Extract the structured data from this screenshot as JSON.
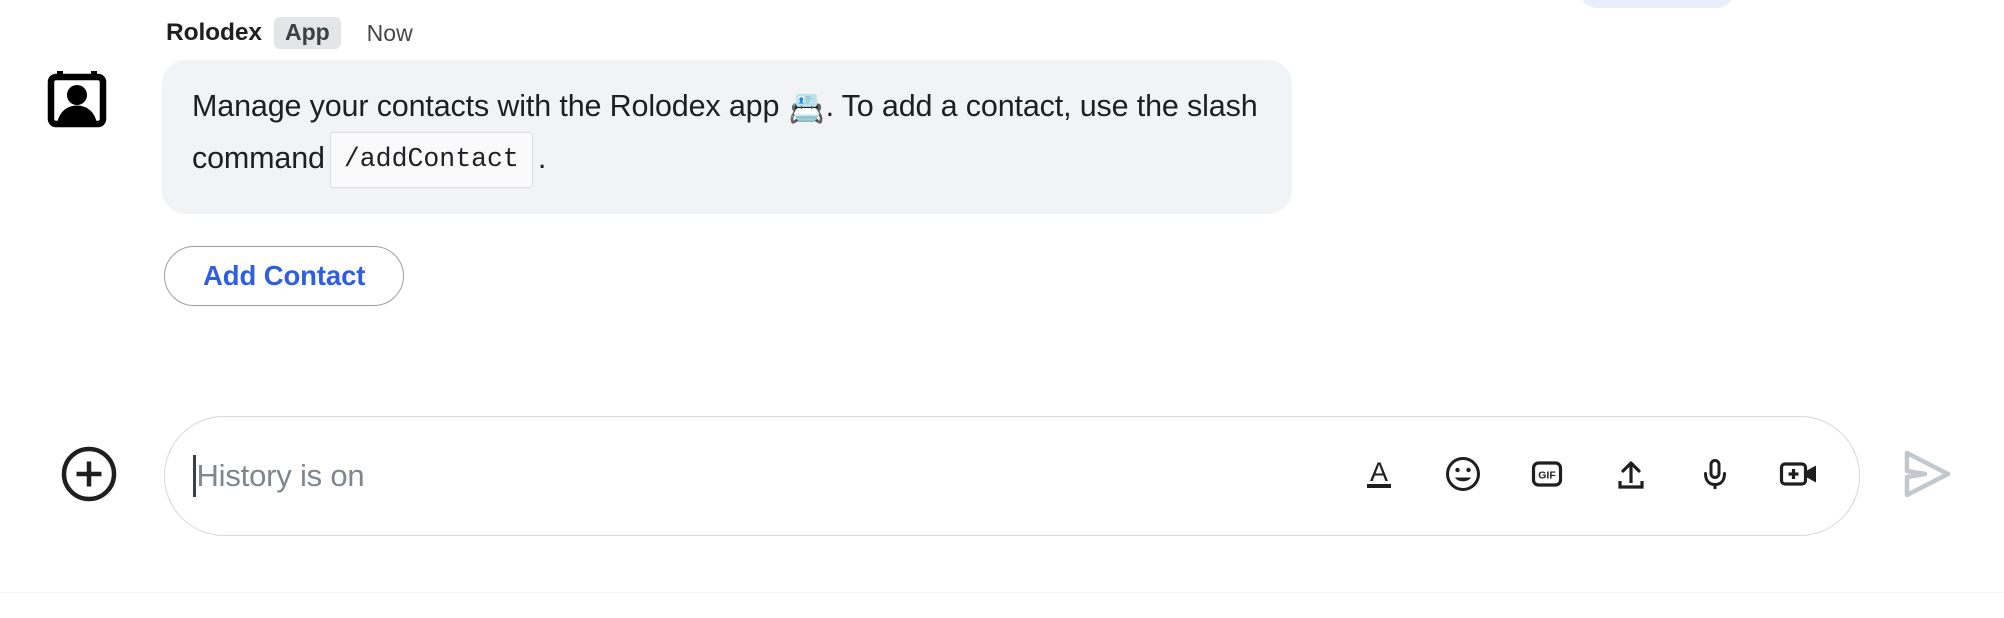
{
  "message": {
    "sender": "Rolodex",
    "badge": "App",
    "timestamp": "Now",
    "avatar_icon": "rolodex-card-contact-icon",
    "text_line1_before_emoji": "Manage your contacts with the Rolodex app ",
    "emoji": "📇",
    "text_line1_after_emoji": ". To add a contact, use the slash",
    "text_line2_before_code": "command",
    "code": "/addContact",
    "text_line2_after_code": ".",
    "action_button": "Add Contact",
    "bubble_bg": "#f1f3f4",
    "action_button_color": "#2f5fe0"
  },
  "composer": {
    "add_label": "+",
    "placeholder": "History is on",
    "value": "",
    "tools": [
      {
        "name": "format-text-icon",
        "label": "A"
      },
      {
        "name": "emoji-icon",
        "label": "☺"
      },
      {
        "name": "gif-icon",
        "label": "GIF"
      },
      {
        "name": "upload-file-icon",
        "label": "↑"
      },
      {
        "name": "microphone-icon",
        "label": "🎙"
      },
      {
        "name": "video-add-icon",
        "label": "+"
      }
    ],
    "send_label": "Send",
    "send_state": "disabled",
    "send_color": "#c3c8ce"
  }
}
